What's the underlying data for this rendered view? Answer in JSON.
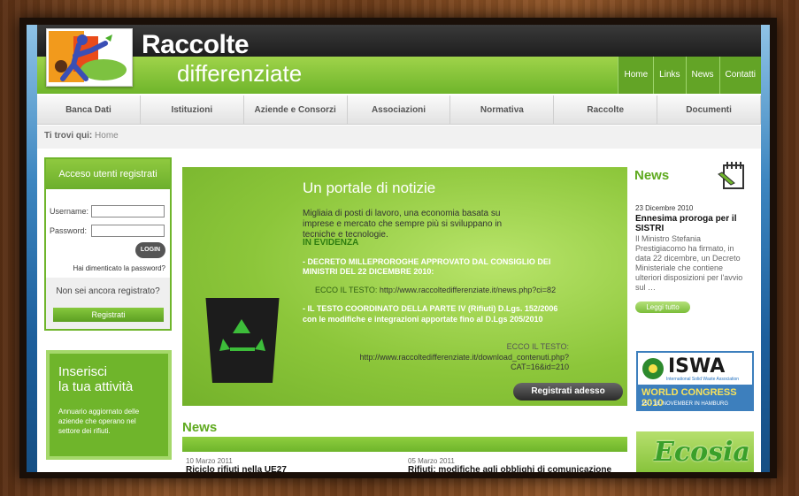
{
  "header": {
    "title_line1": "Raccolte",
    "title_line2": "differenziate"
  },
  "topnav": [
    "Home",
    "Links",
    "News",
    "Contatti"
  ],
  "mainnav": [
    "Banca Dati",
    "Istituzioni",
    "Aziende e Consorzi",
    "Associazioni",
    "Normativa",
    "Raccolte",
    "Documenti"
  ],
  "breadcrumb": {
    "label": "Ti trovi qui:",
    "current": "Home"
  },
  "login": {
    "heading": "Acceso utenti registrati",
    "username_label": "Username:",
    "password_label": "Password:",
    "login_button": "LOGIN",
    "forgot": "Hai dimenticato la password?",
    "not_registered": "Non sei ancora registrato?",
    "register_button": "Registrati"
  },
  "promo": {
    "heading1": "Inserisci",
    "heading2": "la tua attività",
    "text": "Annuario aggiornato delle aziende che operano nel settore dei rifiuti."
  },
  "hero": {
    "title": "Un portale di notizie",
    "intro": "Migliaia di posti di lavoro, una economia basata su imprese e mercato che sempre più si sviluppano in tecniche e tecnologie.",
    "in_evidenza": "IN EVIDENZA",
    "item1": "- DECRETO MILLEPROROGHE APPROVATO DAL CONSIGLIO DEI MINISTRI DEL 22 DICEMBRE 2010:",
    "item1_label": "ECCO IL TESTO:",
    "item1_url": "http://www.raccoltedifferenziate.it/news.php?ci=82",
    "item2": "- IL TESTO COORDINATO DELLA PARTE IV (Rifiuti) D.Lgs. 152/2006 con le modifiche e integrazioni apportate fino al D.Lgs 205/2010",
    "item2_label": "ECCO IL TESTO:",
    "item2_url": "http://www.raccoltedifferenziate.it/download_contenuti.php?CAT=16&id=210",
    "register_button": "Registrati adesso"
  },
  "news": {
    "heading": "News",
    "items": [
      {
        "date": "10 Marzo 2011",
        "title": "Riciclo rifiuti nella UE27"
      },
      {
        "date": "05 Marzo 2011",
        "title": "Rifiuti: modifiche agli obblighi di comunicazione"
      }
    ]
  },
  "sidebar_news": {
    "heading": "News",
    "date": "23 Dicembre 2010",
    "title": "Ennesima proroga per il SISTRI",
    "body": "Il Ministro Stefania Prestigiacomo ha firmato, in data 22 dicembre, un Decreto Ministeriale che contiene ulteriori disposizioni per l'avvio sul …",
    "more": "Leggi tutto"
  },
  "ads": {
    "iswa": "ISWA",
    "iswa_sub": "International Solid Waste Association",
    "iswa_event": "WORLD CONGRESS 2010",
    "iswa_dates": "15. - 18. NOVEMBER IN HAMBURG",
    "ecosia": "Ecosia"
  }
}
